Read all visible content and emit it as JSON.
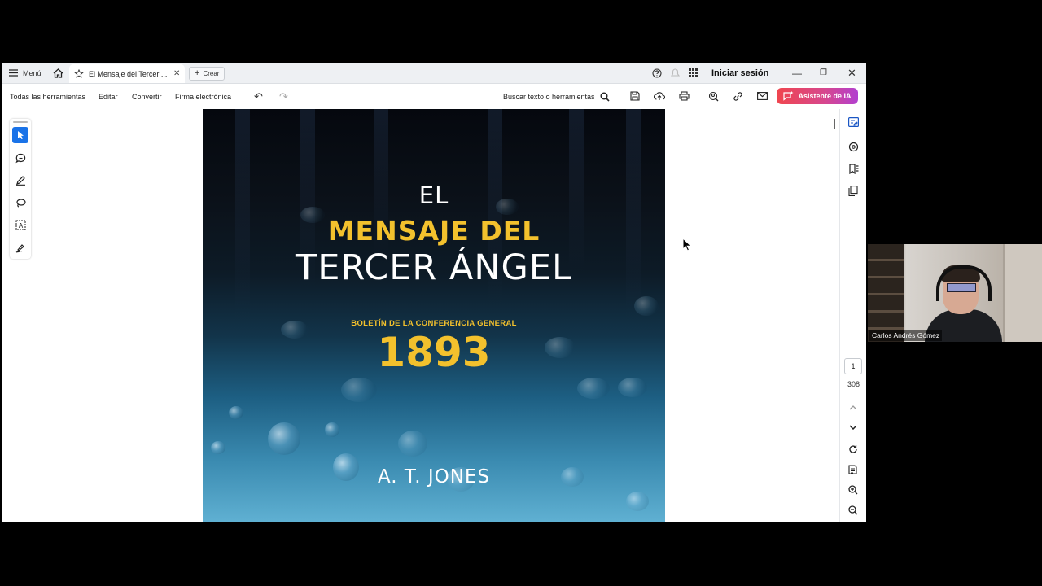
{
  "titlebar": {
    "menu_label": "Menú",
    "tab_title": "El Mensaje del Tercer ...",
    "create_label": "Crear",
    "signin_label": "Iniciar sesión"
  },
  "toolbar": {
    "menus": [
      "Todas las herramientas",
      "Editar",
      "Convertir",
      "Firma electrónica"
    ],
    "search_label": "Buscar texto o herramientas",
    "ai_label": "Asistente de IA"
  },
  "document": {
    "cover": {
      "line1": "EL",
      "line2": "MENSAJE DEL",
      "line3": "TERCER ÁNGEL",
      "subtitle": "BOLETÍN DE LA CONFERENCIA GENERAL",
      "year": "1893",
      "author": "A. T. JONES"
    }
  },
  "navigation": {
    "current_page": "1",
    "total_pages": "308"
  },
  "webcam": {
    "name": "Carlos Andrés Gómez"
  },
  "colors": {
    "accent_blue": "#1a73e8",
    "cover_gold": "#f3c12d",
    "ai_gradient_start": "#f0464e",
    "ai_gradient_end": "#b23fd0"
  },
  "icons": {
    "left_rail": [
      "select-icon",
      "comment-icon",
      "pen-icon",
      "lasso-icon",
      "text-box-icon",
      "sign-icon"
    ],
    "right_rail": [
      "edit-pdf-icon",
      "comments-panel-icon",
      "bookmark-icon",
      "pages-icon",
      "refresh-icon",
      "page-info-icon",
      "zoom-in-icon",
      "zoom-out-icon"
    ]
  }
}
